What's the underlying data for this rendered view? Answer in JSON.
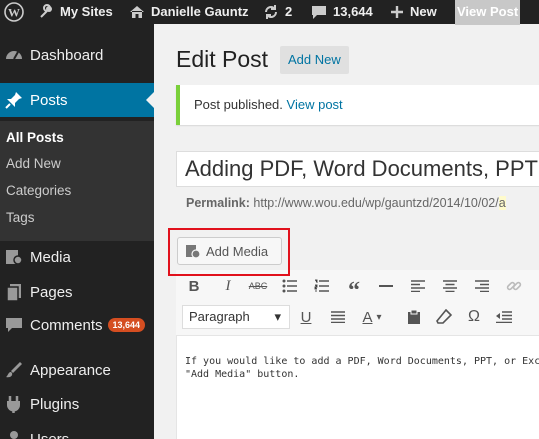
{
  "admin_bar": {
    "wp_logo_icon": "wordpress-icon",
    "my_sites": "My Sites",
    "site_name": "Danielle Gauntz",
    "updates_count": "2",
    "comments_count": "13,644",
    "new_label": "New",
    "view_post": "View Post"
  },
  "sidebar": {
    "dashboard": "Dashboard",
    "posts": "Posts",
    "submenu": [
      "All Posts",
      "Add New",
      "Categories",
      "Tags"
    ],
    "media": "Media",
    "pages": "Pages",
    "comments": "Comments",
    "comments_badge": "13,644",
    "appearance": "Appearance",
    "plugins": "Plugins",
    "users": "Users"
  },
  "main": {
    "page_title": "Edit Post",
    "add_new": "Add New",
    "notice_text": "Post published.",
    "notice_link": "View post",
    "post_title": "Adding PDF, Word Documents, PPT",
    "permalink_label": "Permalink:",
    "permalink_url": "http://www.wou.edu/wp/gauntzd/2014/10/02/",
    "permalink_slug": "a",
    "add_media_label": "Add Media",
    "format_select": "Paragraph",
    "content_line1": "If you would like to add a PDF, Word Documents, PPT, or Excel",
    "content_line2": "\"Add Media\" button."
  },
  "colors": {
    "accent": "#0074a2",
    "notice_border": "#7ad03a",
    "highlight_border": "#e1111c",
    "badge": "#d54e21"
  }
}
